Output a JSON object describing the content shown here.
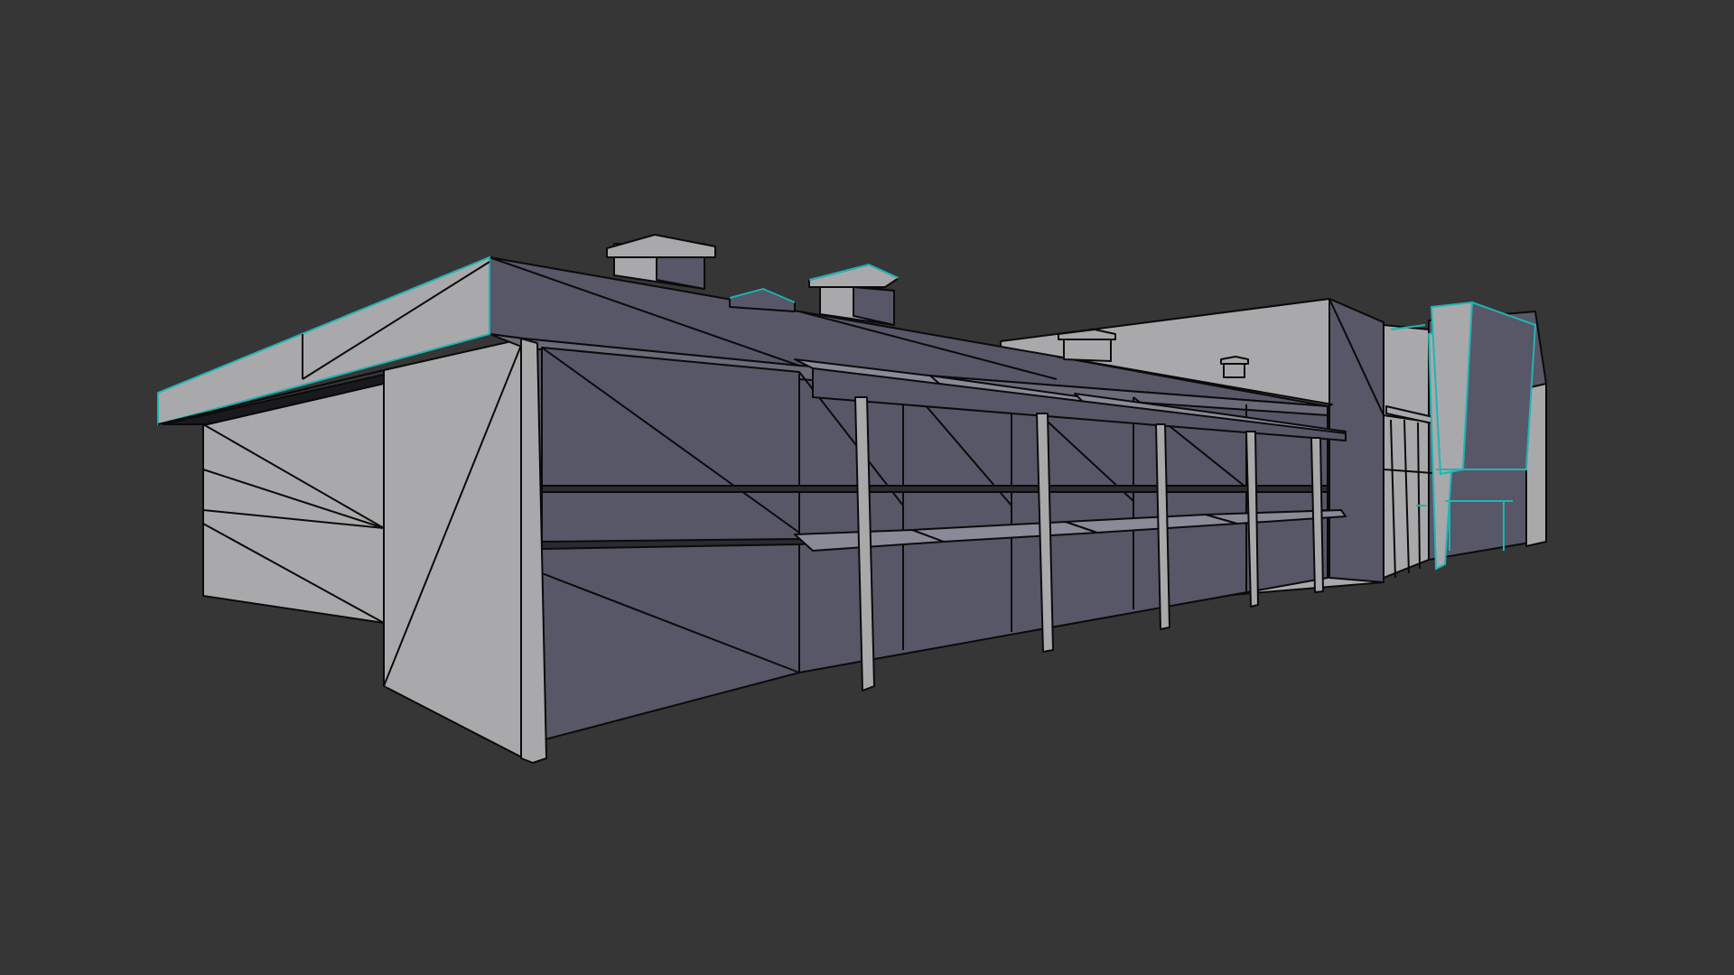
{
  "viewport": {
    "background_color": "#363636"
  },
  "model": {
    "light_face_color": "#a9a9ab",
    "dark_face_color": "#575767",
    "edge_color": "#0a0a0a",
    "selection_color": "#1fb5b5",
    "selected_parts": [
      "left-roof-eave",
      "right-corner-pillar-cluster"
    ]
  }
}
